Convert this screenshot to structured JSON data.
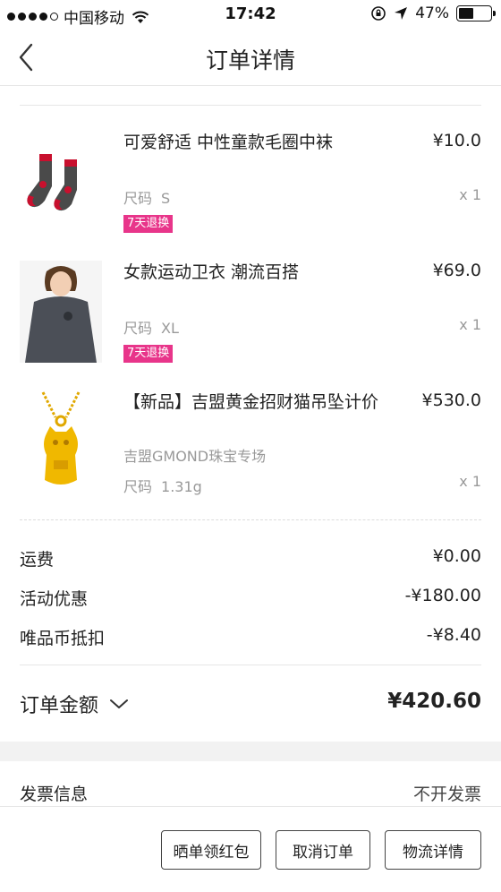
{
  "status_bar": {
    "carrier": "中国移动",
    "time": "17:42",
    "battery": "47%",
    "battery_level": 0.47
  },
  "nav": {
    "title": "订单详情",
    "back_icon": "chevron-left-icon"
  },
  "products": [
    {
      "name": "可爱舒适 中性童款毛圈中袜",
      "price": "¥10.0",
      "size_label": "尺码",
      "size": "S",
      "qty": "x 1",
      "tag": "7天退换"
    },
    {
      "name": "女款运动卫衣 潮流百搭",
      "price": "¥69.0",
      "size_label": "尺码",
      "size": "XL",
      "qty": "x 1",
      "tag": "7天退换"
    },
    {
      "name": "【新品】吉盟黄金招财猫吊坠计价",
      "price": "¥530.0",
      "shop": "吉盟GMOND珠宝专场",
      "size_label": "尺码",
      "size": "1.31g",
      "qty": "x 1"
    }
  ],
  "fees": [
    {
      "label": "运费",
      "value": "¥0.00"
    },
    {
      "label": "活动优惠",
      "value": "-¥180.00"
    },
    {
      "label": "唯品币抵扣",
      "value": "-¥8.40"
    }
  ],
  "total": {
    "label": "订单金额",
    "value": "¥420.60"
  },
  "invoice": {
    "label": "发票信息",
    "value": "不开发票"
  },
  "actions": {
    "share_label": "晒单领红包",
    "cancel_label": "取消订单",
    "logistics_label": "物流详情"
  },
  "colors": {
    "tag": "#e8358a",
    "divider": "#e6e6e6",
    "muted": "#999999"
  }
}
